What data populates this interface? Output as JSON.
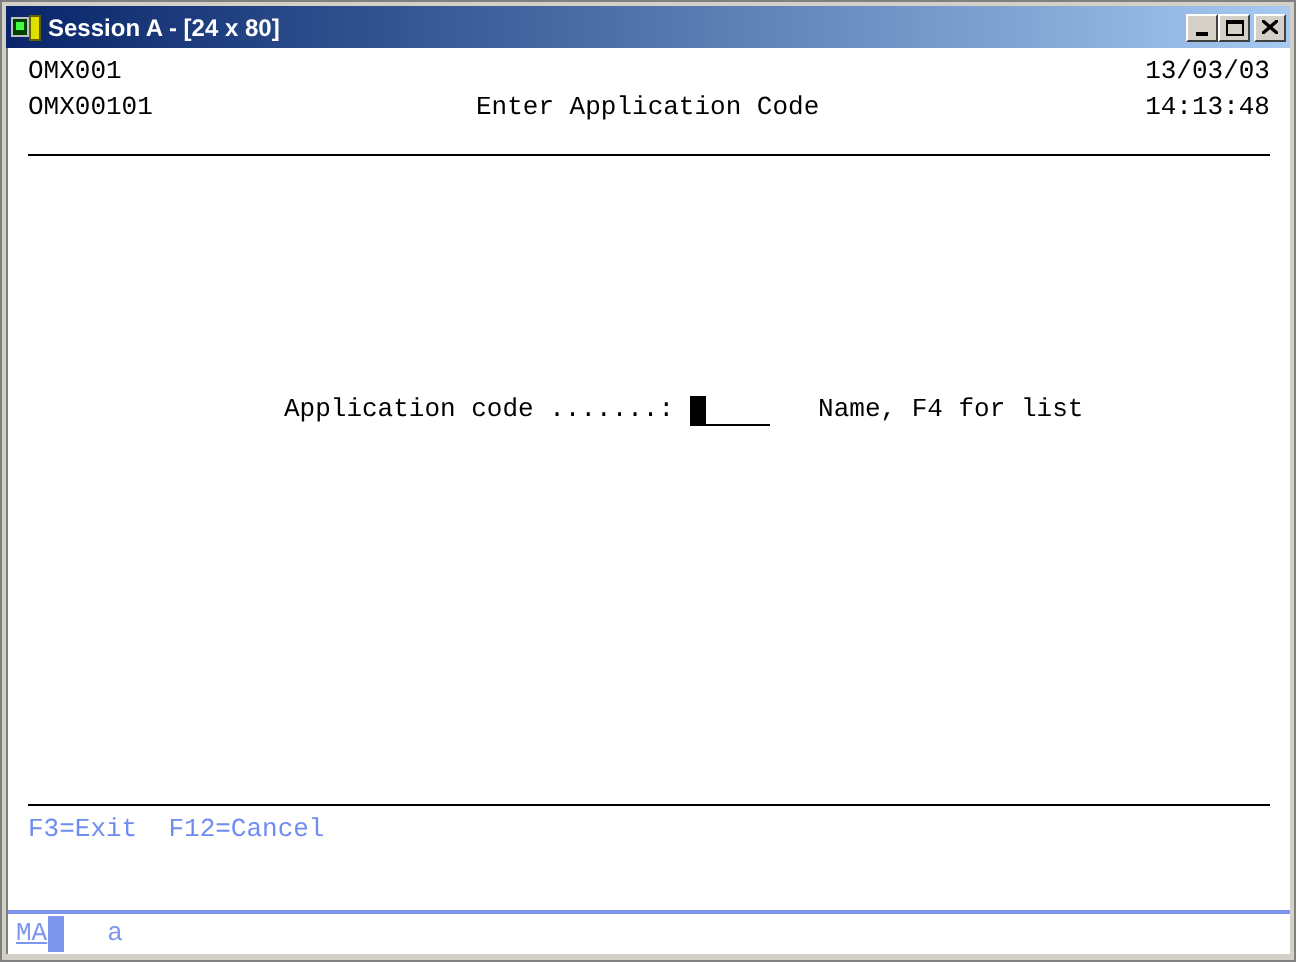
{
  "window": {
    "title": "Session A - [24 x 80]"
  },
  "header": {
    "program": "OMX001",
    "date": "13/03/03",
    "screen_id": "OMX00101",
    "title": "Enter Application Code",
    "time": "14:13:48"
  },
  "field": {
    "label": "Application code .......:",
    "hint": "Name, F4 for list"
  },
  "function_keys": "F3=Exit  F12=Cancel",
  "status_bar": {
    "mode": "MA",
    "indicator": "a"
  }
}
